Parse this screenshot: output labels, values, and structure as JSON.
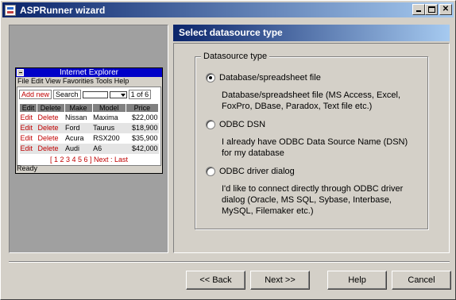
{
  "window": {
    "title": "ASPRunner wizard"
  },
  "preview": {
    "ie_title": "Internet Explorer",
    "menu": "File Edit View Favorities Tools Help",
    "add_new": "Add new",
    "search_label": "Search",
    "page_of": "1 of 6",
    "columns": [
      "Edit",
      "Delete",
      "Make",
      "Model",
      "Price"
    ],
    "rows": [
      [
        "Edit",
        "Delete",
        "Nissan",
        "Maxima",
        "$22,000"
      ],
      [
        "Edit",
        "Delete",
        "Ford",
        "Taurus",
        "$18,900"
      ],
      [
        "Edit",
        "Delete",
        "Acura",
        "RSX200",
        "$35,900"
      ],
      [
        "Edit",
        "Delete",
        "Audi",
        "A6",
        "$42,000"
      ]
    ],
    "pager": "[ 1 2 3 4 5 6 ]  Next : Last",
    "status": "Ready"
  },
  "header": {
    "title": "Select datasource type"
  },
  "group": {
    "legend": "Datasource type"
  },
  "options": [
    {
      "label": "Database/spreadsheet file",
      "checked": true,
      "description": "Database/spreadsheet file (MS Access, Excel, FoxPro, DBase, Paradox, Text file etc.)"
    },
    {
      "label": "ODBC DSN",
      "checked": false,
      "description": "I already have ODBC Data Source Name (DSN)  for my database"
    },
    {
      "label": "ODBC driver dialog",
      "checked": false,
      "description": "I'd like to connect directly through ODBC driver dialog (Oracle, MS SQL, Sybase, Interbase, MySQL, Filemaker etc.)"
    }
  ],
  "buttons": {
    "back": "<< Back",
    "next": "Next >>",
    "help": "Help",
    "cancel": "Cancel"
  }
}
